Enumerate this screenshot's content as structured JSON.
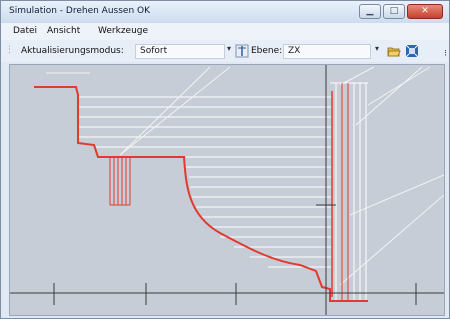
{
  "window": {
    "title": "Simulation - Drehen Aussen OK"
  },
  "menu": {
    "items": [
      "Datei",
      "Ansicht",
      "Werkzeuge"
    ]
  },
  "toolbar": {
    "mode_label": "Aktualisierungsmodus:",
    "mode_value": "Sofort",
    "plane_label": "Ebene:",
    "plane_value": "ZX"
  },
  "icons": [
    "grip-icon",
    "dropdown-arrow-icon",
    "plane-tool-icon",
    "open-folder-icon",
    "fit-view-icon",
    "minimize-icon",
    "maximize-icon",
    "close-icon"
  ],
  "colors": {
    "toolpath": "#e03b2e",
    "passes": "#ffffff",
    "axis": "#3a3a3a",
    "background": "#c6cdd6"
  }
}
